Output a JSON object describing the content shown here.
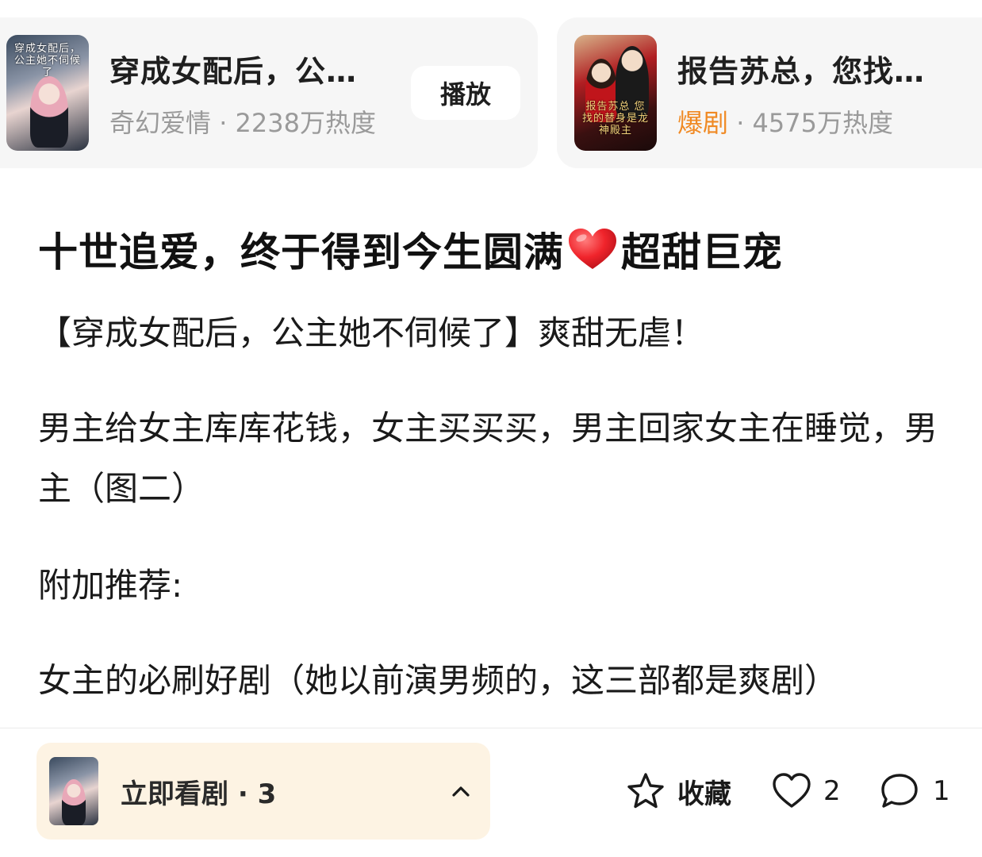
{
  "cards": [
    {
      "title": "穿成女配后，公…",
      "poster_text": "穿成女配后，公主她不伺候了",
      "genre": "奇幻爱情",
      "heat": " · 2238万热度",
      "play_label": "播放"
    },
    {
      "title": "报告苏总，您找…",
      "poster_text": "报告苏总 您找的替身是龙神殿主",
      "genre": "爆剧",
      "heat": " · 4575万热度",
      "genre_color": "#f08a24"
    }
  ],
  "post": {
    "title_before_emoji": "十世追爱，终于得到今生圆满",
    "title_emoji": "heart-emoji",
    "title_after_emoji": "超甜巨宠",
    "paragraphs": [
      "【穿成女配后，公主她不伺候了】爽甜无虐！",
      "男主给女主库库花钱，女主买买买，男主回家女主在睡觉，男主（图二）",
      "附加推荐:",
      "女主的必刷好剧（她以前演男频的，这三部都是爽剧）"
    ]
  },
  "bottom_bar": {
    "watch_label": "立即看剧 · 3",
    "favorite_label": "收藏",
    "like_count": "2",
    "comment_count": "1"
  },
  "colors": {
    "accent_orange": "#f08a24",
    "card_bg": "#f6f6f6",
    "watch_bar_bg": "#fdf3e3"
  }
}
